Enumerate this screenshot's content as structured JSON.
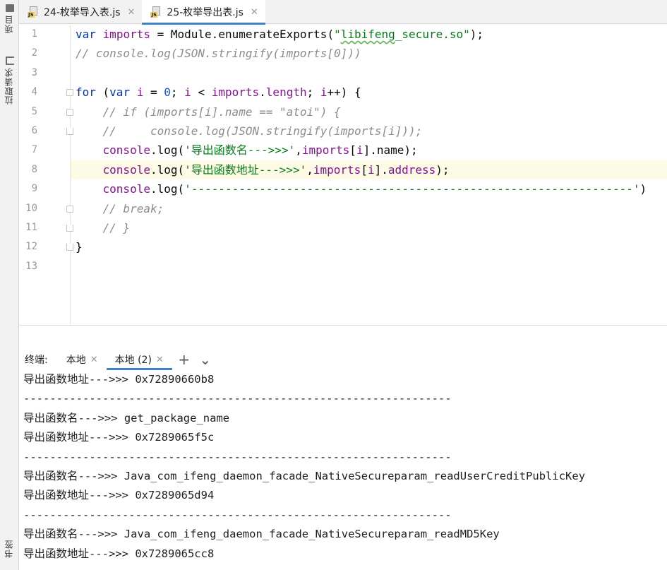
{
  "left_strip": {
    "tools": [
      {
        "label": "项目",
        "icon": "folder-icon"
      },
      {
        "label": "拉取请求",
        "icon": "pull-request-icon"
      },
      {
        "label": "书签",
        "icon": "bookmark-icon"
      }
    ]
  },
  "tabs": [
    {
      "label": "24-枚举导入表.js",
      "badge": "JS",
      "close": "✕",
      "active": false
    },
    {
      "label": "25-枚举导出表.js",
      "badge": "JS",
      "close": "✕",
      "active": true
    }
  ],
  "editor": {
    "line_numbers": [
      "1",
      "2",
      "3",
      "4",
      "5",
      "6",
      "7",
      "8",
      "9",
      "10",
      "11",
      "12",
      "13"
    ],
    "lines": [
      [
        {
          "t": "var",
          "c": "kw"
        },
        {
          "t": " "
        },
        {
          "t": "imports",
          "c": "fld"
        },
        {
          "t": " = Module.enumerateExports("
        },
        {
          "t": "\"",
          "c": "str"
        },
        {
          "t": "libifeng",
          "c": "str sq"
        },
        {
          "t": "_secure.so\"",
          "c": "str"
        },
        {
          "t": ");"
        }
      ],
      [
        {
          "t": "// console.log(JSON.stringify(imports[0]))",
          "c": "cmt"
        }
      ],
      [],
      [
        {
          "t": "for",
          "c": "kw"
        },
        {
          "t": " ("
        },
        {
          "t": "var",
          "c": "kw"
        },
        {
          "t": " "
        },
        {
          "t": "i",
          "c": "fld"
        },
        {
          "t": " = "
        },
        {
          "t": "0",
          "c": "num"
        },
        {
          "t": "; "
        },
        {
          "t": "i",
          "c": "fld"
        },
        {
          "t": " < "
        },
        {
          "t": "imports",
          "c": "fld"
        },
        {
          "t": "."
        },
        {
          "t": "length",
          "c": "fld"
        },
        {
          "t": "; "
        },
        {
          "t": "i",
          "c": "fld"
        },
        {
          "t": "++) {"
        }
      ],
      [
        {
          "t": "    "
        },
        {
          "t": "// if (imports[i].name == \"atoi\") {",
          "c": "cmt"
        }
      ],
      [
        {
          "t": "    "
        },
        {
          "t": "//     console.log(JSON.stringify(imports[i]));",
          "c": "cmt"
        }
      ],
      [
        {
          "t": "    "
        },
        {
          "t": "console",
          "c": "fld"
        },
        {
          "t": ".log("
        },
        {
          "t": "'导出函数名--->>>'",
          "c": "str"
        },
        {
          "t": ","
        },
        {
          "t": "imports",
          "c": "fld"
        },
        {
          "t": "["
        },
        {
          "t": "i",
          "c": "fld"
        },
        {
          "t": "].name);"
        }
      ],
      [
        {
          "t": "    "
        },
        {
          "t": "console",
          "c": "fld"
        },
        {
          "t": ".log("
        },
        {
          "t": "'导出函数地址--->>>'",
          "c": "str"
        },
        {
          "t": ","
        },
        {
          "t": "imports",
          "c": "fld"
        },
        {
          "t": "["
        },
        {
          "t": "i",
          "c": "fld"
        },
        {
          "t": "]."
        },
        {
          "t": "address",
          "c": "fld"
        },
        {
          "t": ");"
        }
      ],
      [
        {
          "t": "    "
        },
        {
          "t": "console",
          "c": "fld"
        },
        {
          "t": ".log("
        },
        {
          "t": "'-----------------------------------------------------------------'",
          "c": "str"
        },
        {
          "t": ")"
        }
      ],
      [
        {
          "t": "    "
        },
        {
          "t": "// break;",
          "c": "cmt"
        }
      ],
      [
        {
          "t": "    "
        },
        {
          "t": "// }",
          "c": "cmt"
        }
      ],
      [
        {
          "t": "}"
        }
      ],
      []
    ]
  },
  "terminal": {
    "title": "终端:",
    "tabs": [
      {
        "label": "本地",
        "close": "✕",
        "active": false
      },
      {
        "label": "本地 (2)",
        "close": "✕",
        "active": true
      }
    ],
    "add_button": "+",
    "menu_button": "⌄",
    "output": [
      "导出函数地址--->>> 0x72890660b8",
      "-----------------------------------------------------------------",
      "导出函数名--->>> get_package_name",
      "导出函数地址--->>> 0x7289065f5c",
      "-----------------------------------------------------------------",
      "导出函数名--->>> Java_com_ifeng_daemon_facade_NativeSecureparam_readUserCreditPublicKey",
      "导出函数地址--->>> 0x7289065d94",
      "-----------------------------------------------------------------",
      "导出函数名--->>> Java_com_ifeng_daemon_facade_NativeSecureparam_readMD5Key",
      "导出函数地址--->>> 0x7289065cc8"
    ]
  }
}
